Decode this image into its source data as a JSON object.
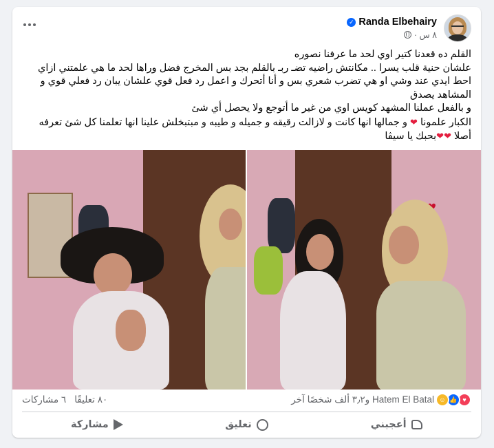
{
  "post": {
    "author": "Randa Elbehairy",
    "time": "٨ س ·",
    "text_lines": [
      "القلم ده قعدنا كتير اوي لحد ما عرفنا نصوره",
      "علشان حنية قلب يسرا .. مكانتش راضيه تضـ ربـ بالقلم  بجد بس المخرج فضل وراها لحد ما هي علمتني ازاي احط ايدي عند وشي او هي تضرب شعري بس و أنا أتحرك و اعمل رد فعل قوي علشان يبان رد فعلي قوي و المشاهد يصدق",
      "و بالفعل عملنا المشهد كويس اوي من غير ما أتوجع ولا يحصل أي شئ",
      "الكبار علمونا",
      "و جمالها انها كانت و لازالت رقيقه و جميله و طيبه و مبتبخلش علينا انها تعلمنا كل شئ تعرفه أصلا",
      "بحبك يا سيڤا"
    ]
  },
  "stats": {
    "reactors": "Hatem El Batal و٣٫٢ ألف شخصًا آخر",
    "comments": "٨٠ تعليقًا",
    "shares": "٦ مشاركات"
  },
  "actions": {
    "like": "أعجبني",
    "comment": "تعليق",
    "share": "مشاركة"
  },
  "icons": [
    "more-icon",
    "verified-icon",
    "globe-icon",
    "heart-reaction-icon",
    "like-reaction-icon",
    "care-reaction-icon",
    "like-icon",
    "comment-icon",
    "share-icon"
  ],
  "colors": {
    "accent": "#0866ff",
    "heart": "#e41e3f",
    "muted": "#65676b"
  }
}
